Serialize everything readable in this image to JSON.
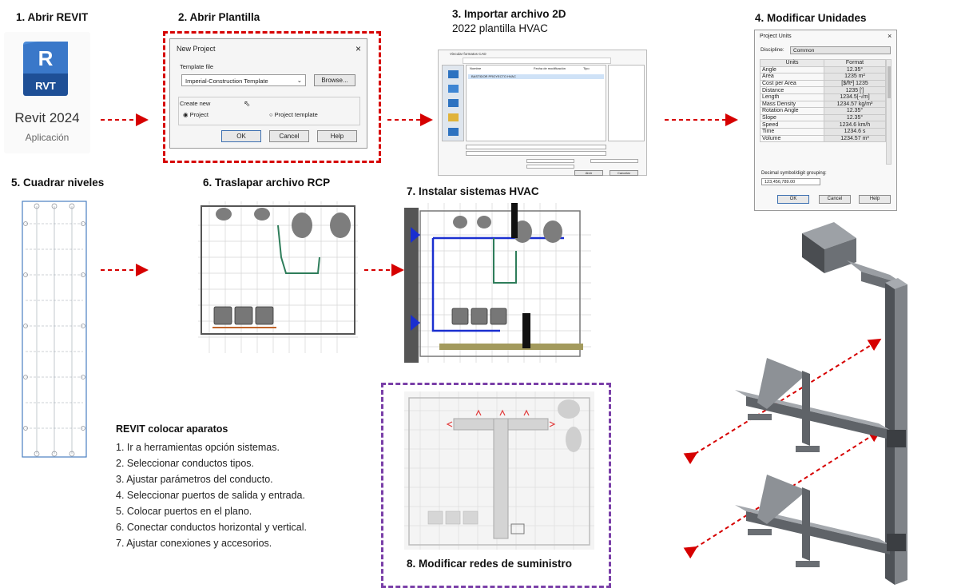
{
  "steps": {
    "s1": "1. Abrir REVIT",
    "s2": "2. Abrir Plantilla",
    "s3": "3. Importar archivo 2D",
    "s3_sub": "2022 plantilla HVAC",
    "s4": "4. Modificar Unidades",
    "s5": "5. Cuadrar niveles",
    "s6": "6. Traslapar archivo RCP",
    "s7": "7. Instalar sistemas HVAC",
    "s8": "8. Modificar redes de suministro"
  },
  "revit": {
    "logo_letter": "R",
    "logo_badge": "RVT",
    "name": "Revit 2024",
    "subtitle": "Aplicación"
  },
  "new_project": {
    "title": "New Project",
    "close": "×",
    "template_label": "Template file",
    "template_value": "Imperial-Construction Template",
    "browse": "Browse...",
    "create_new": "Create new",
    "opt_project": "Project",
    "opt_template": "Project template",
    "ok": "OK",
    "cancel": "Cancel",
    "help": "Help"
  },
  "import_dialog": {
    "title": "Vincular formatos CAD",
    "file_row": "BASTIDOR PROYECTO HVAC",
    "col_name": "Nombre",
    "col_date": "Fecha de modificación",
    "col_type": "Tipo",
    "btn_open": "Abrir",
    "btn_cancel": "Cancelar"
  },
  "project_units": {
    "title": "Project Units",
    "close": "×",
    "discipline_label": "Discipline:",
    "discipline_value": "Common",
    "col_units": "Units",
    "col_format": "Format",
    "rows": [
      {
        "unit": "Angle",
        "format": "12.35°"
      },
      {
        "unit": "Area",
        "format": "1235 m²"
      },
      {
        "unit": "Cost per Area",
        "format": "[$/ft²] 1235"
      },
      {
        "unit": "Distance",
        "format": "1235 [']"
      },
      {
        "unit": "Length",
        "format": "1234.5[-√m]"
      },
      {
        "unit": "Mass Density",
        "format": "1234.57 kg/m³"
      },
      {
        "unit": "Rotation Angle",
        "format": "12.35°"
      },
      {
        "unit": "Slope",
        "format": "12.35°"
      },
      {
        "unit": "Speed",
        "format": "1234.6 km/h"
      },
      {
        "unit": "Time",
        "format": "1234.6 s"
      },
      {
        "unit": "Volume",
        "format": "1234.57 m³"
      }
    ],
    "decimal_label": "Decimal symbol/digit grouping:",
    "decimal_value": "123,456,789.00",
    "ok": "OK",
    "cancel": "Cancel",
    "help": "Help"
  },
  "instructions": {
    "title": "REVIT colocar aparatos",
    "items": [
      "1.   Ir a herramientas opción sistemas.",
      "2.   Seleccionar conductos tipos.",
      "3.   Ajustar parámetros del conducto.",
      "4.   Seleccionar puertos de salida y entrada.",
      "5.   Colocar puertos en el plano.",
      "6.   Conectar conductos horizontal y vertical.",
      "7.   Ajustar conexiones y accesorios."
    ]
  },
  "colors": {
    "arrow_red": "#d60000",
    "dash_red": "#d60000",
    "dash_purple": "#7a3fa8",
    "hvac_blue": "#1a2fd0",
    "revit_blue": "#1e5fb8",
    "steel": "#8d9196"
  }
}
